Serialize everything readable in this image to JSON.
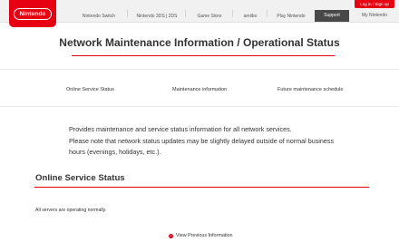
{
  "header": {
    "logo_text": "Nintendo",
    "nav": [
      "Nintendo Switch",
      "Nintendo 3DS | 2DS",
      "Game Store",
      "amiibo",
      "Play Nintendo"
    ],
    "support_label": "Support",
    "my_nintendo_label": "My Nintendo",
    "login_label": "Log in / Sign up"
  },
  "page": {
    "title": "Network Maintenance Information / Operational Status"
  },
  "subnav": {
    "items": [
      "Online Service Status",
      "Maintenance information",
      "Future maintenance schedule"
    ]
  },
  "intro": {
    "line1": "Provides maintenance and service status information for all network services.",
    "line2": "Please note that network status updates may be slightly delayed outside of normal business hours (evenings, holidays, etc.)."
  },
  "online_status": {
    "heading": "Online Service Status",
    "message": "All servers are operating normally.",
    "previous_link": "View Previous Information"
  },
  "colors": {
    "brand_red": "#e60012",
    "dark_tab": "#484848",
    "topbar_bg": "#f1f1f1"
  },
  "icons": {
    "logo": "nintendo-logo",
    "previous_link": "circle-arrow-right-icon"
  }
}
